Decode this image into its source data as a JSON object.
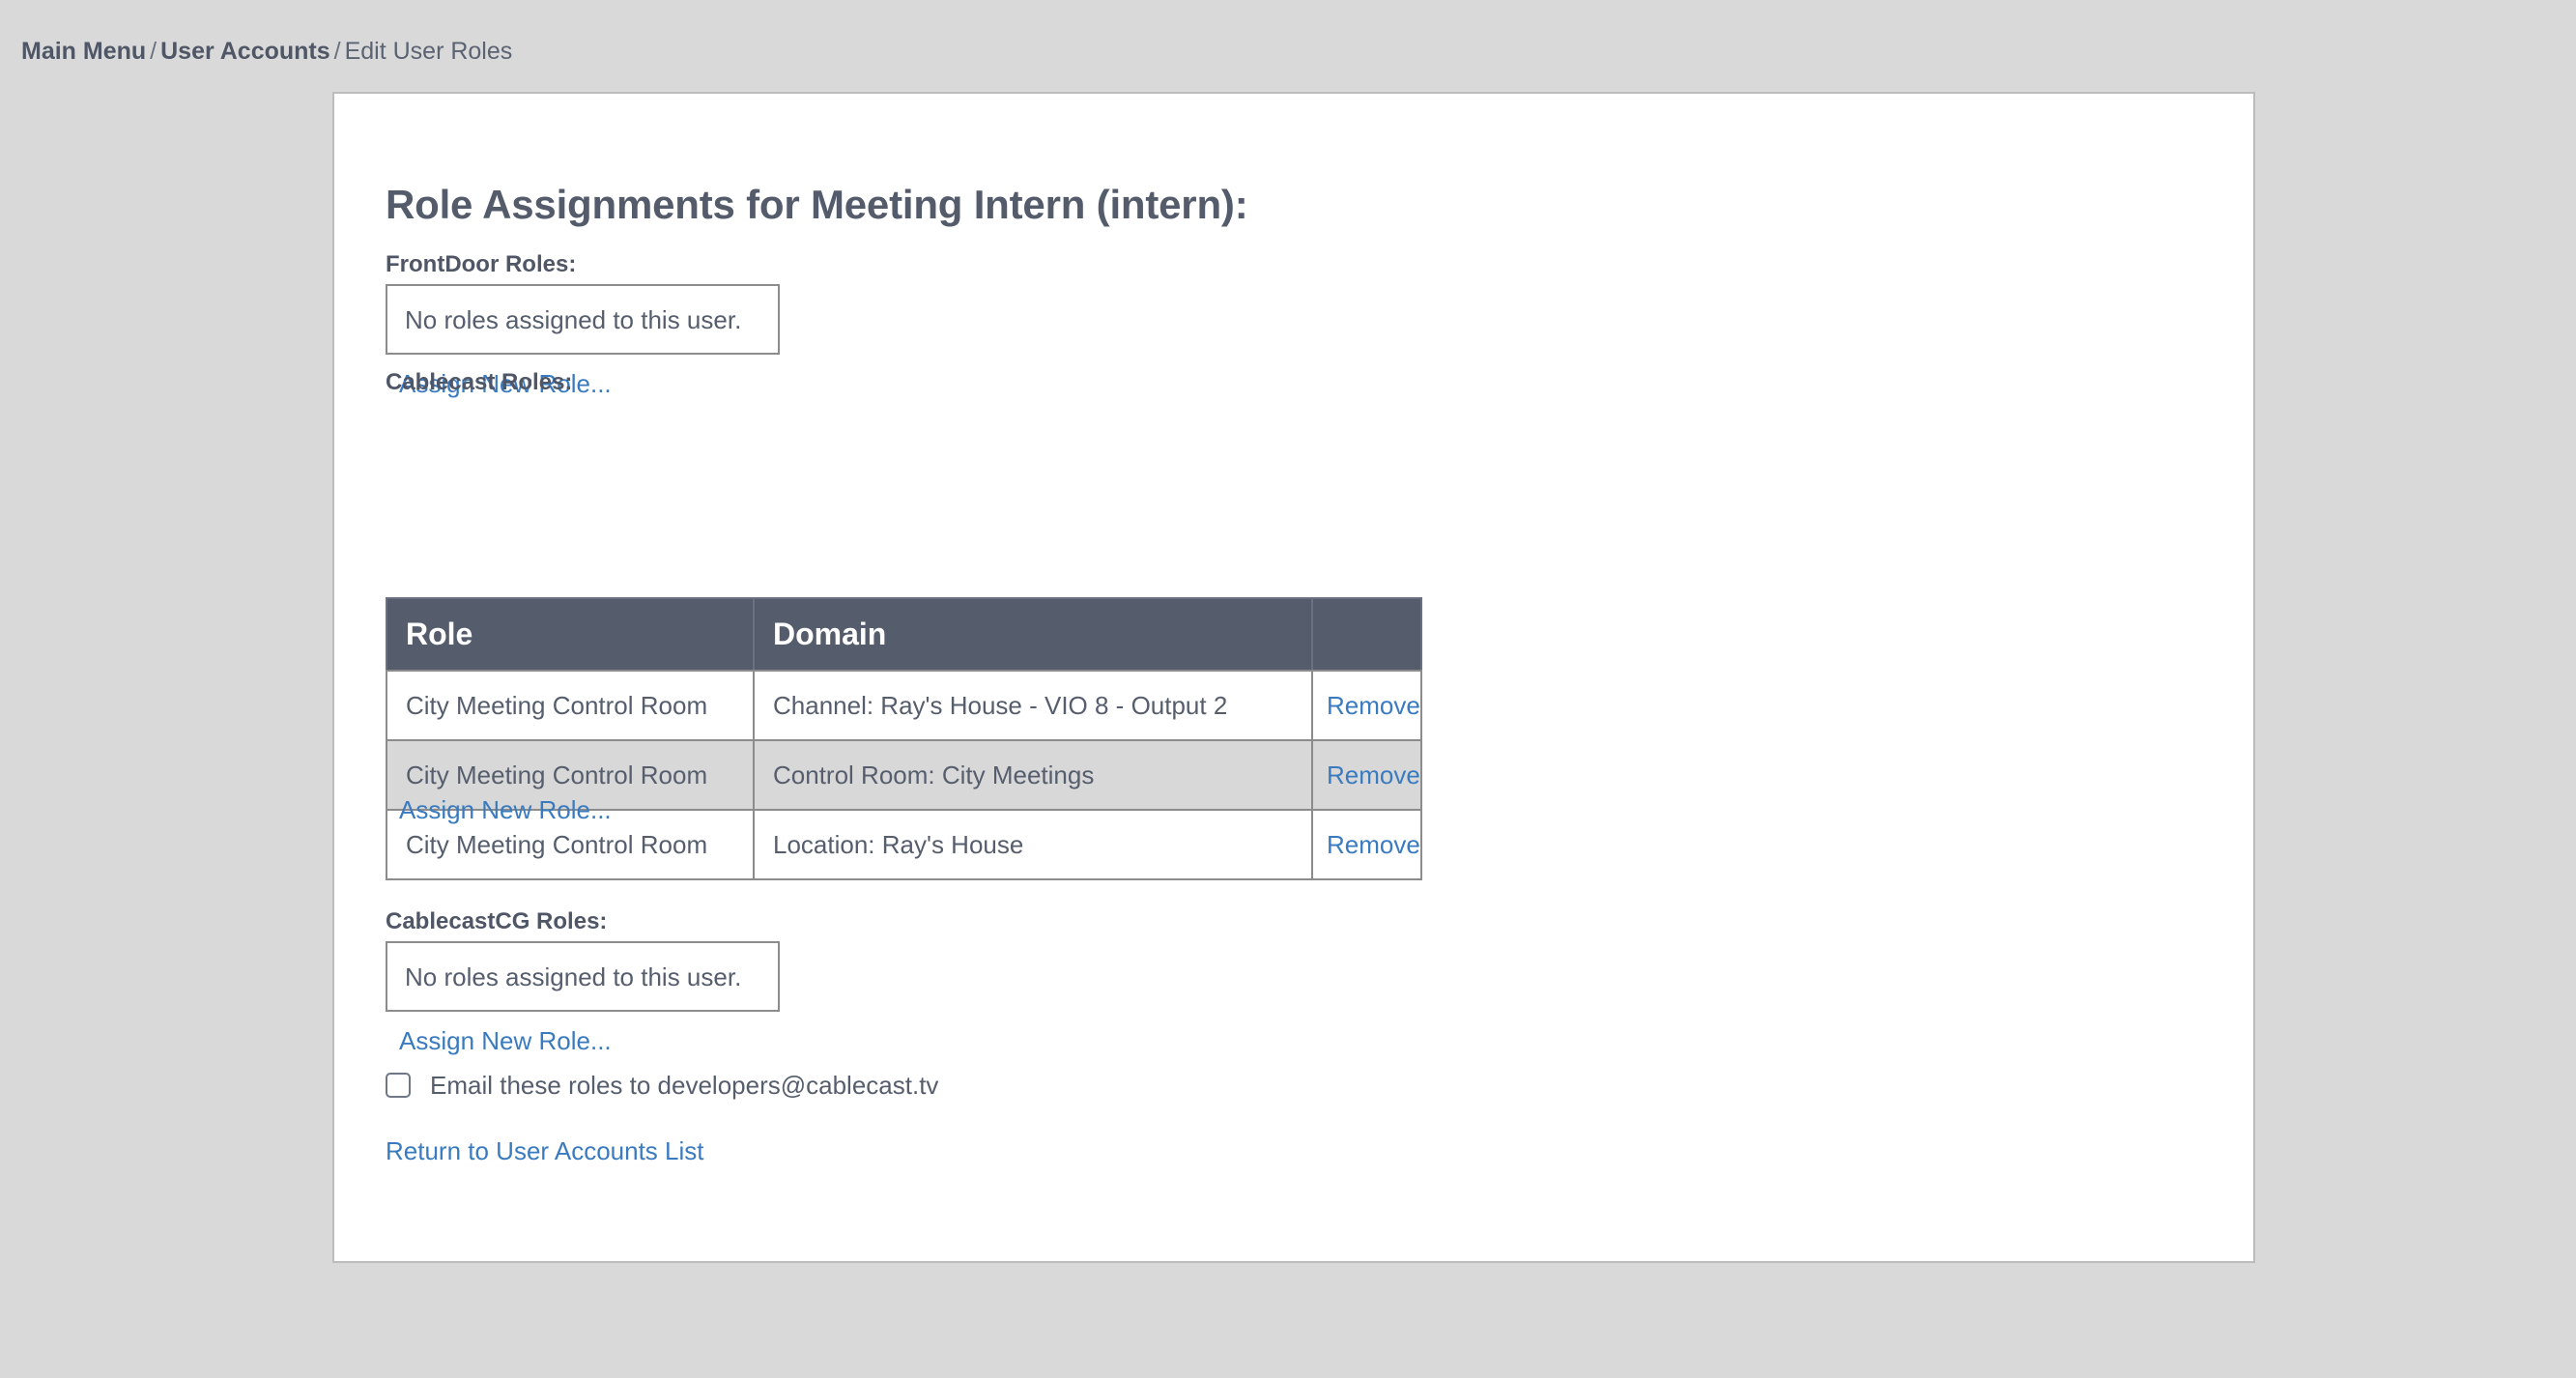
{
  "breadcrumb": {
    "items": [
      {
        "label": "Main Menu",
        "strong": true
      },
      {
        "label": "User Accounts",
        "strong": true
      },
      {
        "label": "Edit User Roles",
        "strong": false
      }
    ],
    "separator": "/"
  },
  "page": {
    "title": "Role Assignments for Meeting Intern (intern):"
  },
  "sections": {
    "frontdoor": {
      "label": "FrontDoor Roles:",
      "empty_text": "No roles assigned to this user.",
      "assign_link": "Assign New Role..."
    },
    "cablecast": {
      "label": "Cablecast Roles:",
      "assign_link": "Assign New Role...",
      "table": {
        "columns": [
          "Role",
          "Domain",
          ""
        ],
        "rows": [
          {
            "role": "City Meeting Control Room",
            "domain": "Channel: Ray's House - VIO 8 - Output 2",
            "action": "Remove",
            "striped": false
          },
          {
            "role": "City Meeting Control Room",
            "domain": "Control Room: City Meetings",
            "action": "Remove",
            "striped": true
          },
          {
            "role": "City Meeting Control Room",
            "domain": "Location: Ray's House",
            "action": "Remove",
            "striped": false
          }
        ]
      }
    },
    "cablecastcg": {
      "label": "CablecastCG Roles:",
      "empty_text": "No roles assigned to this user.",
      "assign_link": "Assign New Role..."
    }
  },
  "footer": {
    "email_checkbox_label": "Email these roles to developers@cablecast.tv",
    "email_checkbox_checked": false,
    "return_link": "Return to User Accounts List"
  },
  "colors": {
    "page_background": "#d9d9d9",
    "card_background": "#ffffff",
    "card_border": "#bcbcbc",
    "text": "#555c6c",
    "link": "#3a7bbf",
    "table_header_background": "#555c6c",
    "table_header_text": "#ffffff",
    "table_border": "#8c8c8c",
    "table_stripe": "#d8d8d8"
  }
}
